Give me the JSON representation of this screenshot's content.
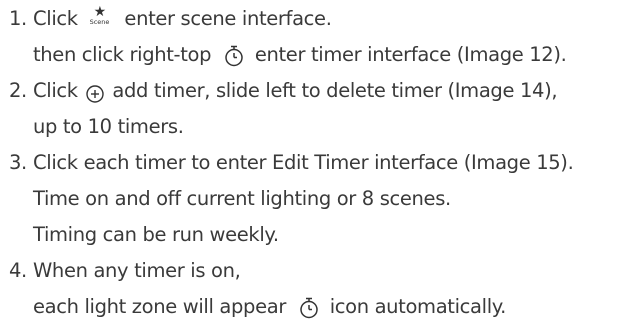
{
  "instructions": {
    "items": [
      {
        "number": "1.",
        "part1": "Click",
        "scene_icon_label": "Scene",
        "part2": "enter scene interface.",
        "line2_part1": "then click right-top",
        "line2_part2": "enter timer interface (Image 12)."
      },
      {
        "number": "2.",
        "part1": "Click",
        "part2": "add timer, slide left to delete timer (Image 14),",
        "line2": "up to 10 timers."
      },
      {
        "number": "3.",
        "text": "Click each timer to enter Edit Timer interface (Image 15).",
        "line2": "Time on and off current lighting or 8 scenes.",
        "line3": "Timing can be run weekly."
      },
      {
        "number": "4.",
        "text": "When any timer is on,",
        "line2_part1": "each light zone will appear",
        "line2_part2": "icon automatically."
      }
    ],
    "icons": {
      "scene": "star-scene-icon",
      "timer": "timer-icon",
      "add": "plus-circle-icon"
    },
    "text_color": "#3a3a3a"
  }
}
